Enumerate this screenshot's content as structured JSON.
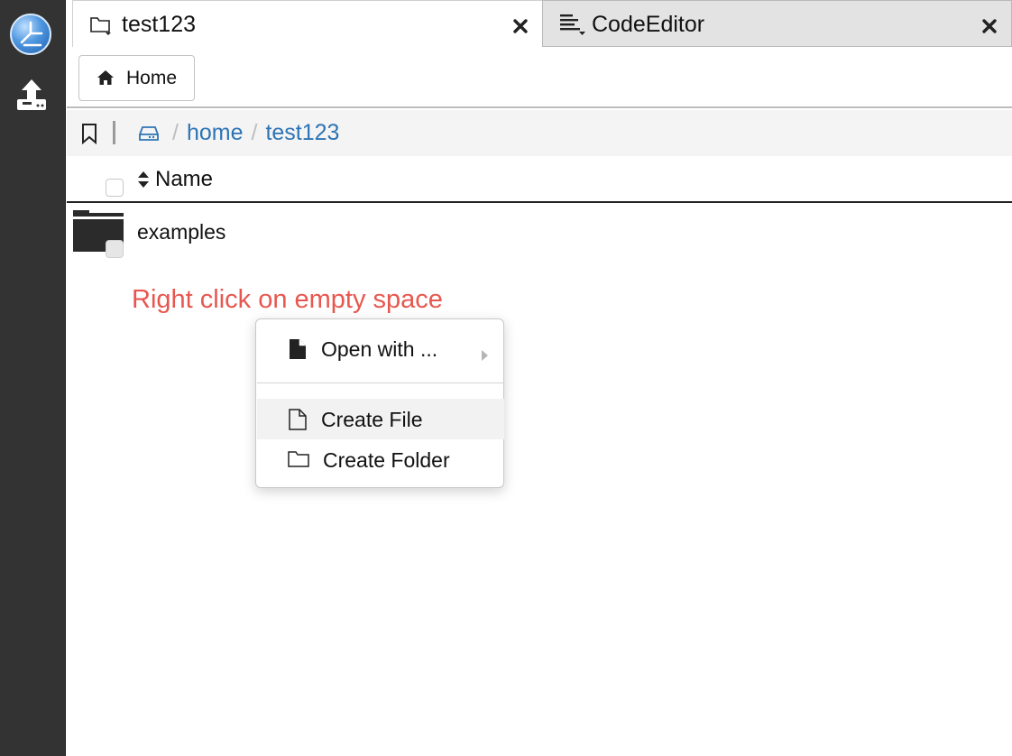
{
  "sidebar": {
    "logo": "app-logo-icon",
    "upload_icon": "upload-icon"
  },
  "tabs": [
    {
      "label": "test123",
      "icon": "folder-icon",
      "close_icon": "close-icon",
      "active": true
    },
    {
      "label": "CodeEditor",
      "icon": "code-editor-icon",
      "close_icon": "close-icon",
      "active": false
    }
  ],
  "toolbar": {
    "home_label": "Home",
    "home_icon": "home-icon"
  },
  "breadcrumb": {
    "bookmark_icon": "bookmark-icon",
    "drive_icon": "drive-icon",
    "separator": "/",
    "items": [
      "home",
      "test123"
    ]
  },
  "list": {
    "header_name": "Name",
    "sort_icon": "sort-icon",
    "rows": [
      {
        "name": "examples",
        "type": "folder"
      }
    ]
  },
  "annotation": "Right click on empty space",
  "context_menu": {
    "items": [
      {
        "label": "Open with ...",
        "icon": "file-icon",
        "has_submenu": true
      },
      {
        "label": "Create File",
        "icon": "new-file-icon",
        "hovered": true
      },
      {
        "label": "Create Folder",
        "icon": "new-folder-icon"
      }
    ]
  },
  "colors": {
    "sidebar_bg": "#333333",
    "link": "#2e74b5",
    "annotation": "#e8574f",
    "inactive_tab": "#e3e3e3"
  }
}
